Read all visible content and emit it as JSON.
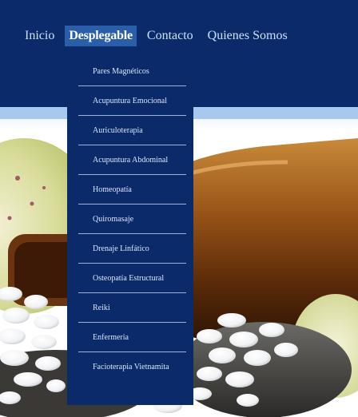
{
  "nav": {
    "items": [
      {
        "label": "Inicio",
        "active": false
      },
      {
        "label": "Desplegable",
        "active": true
      },
      {
        "label": "Contacto",
        "active": false
      },
      {
        "label": "Quienes Somos",
        "active": false
      }
    ]
  },
  "dropdown": {
    "items": [
      "Pares Magnéticos",
      "Acupuntura Emocional",
      "Auriculoterapia",
      "Acupuntura Abdominal",
      "Homeopatía",
      "Quiromasaje",
      "Drenaje Linfático",
      "Osteopatía Estructural",
      "Reiki",
      "Enfermeria",
      "Facioterapia Vietnamita"
    ]
  },
  "colors": {
    "header": "#0a2a6a",
    "active_tab": "#2b5ea8",
    "stripe": "#a8c8ee",
    "nav_text": "#cfe0ff"
  }
}
